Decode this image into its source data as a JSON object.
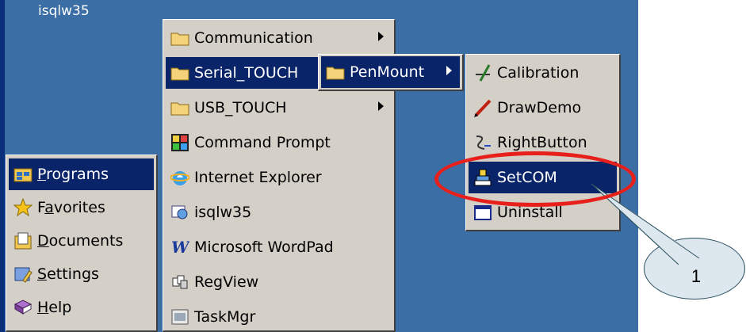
{
  "desktop": {
    "label": "isqlw35"
  },
  "start_menu": {
    "items": [
      {
        "label": "Programs",
        "icon": "programs-folder-icon",
        "selected": true,
        "underline_first": true
      },
      {
        "label": "Favorites",
        "icon": "star-icon",
        "selected": false,
        "underline_char": "a"
      },
      {
        "label": "Documents",
        "icon": "documents-icon",
        "selected": false,
        "underline_first": true
      },
      {
        "label": "Settings",
        "icon": "settings-icon",
        "selected": false,
        "underline_first": true
      },
      {
        "label": "Help",
        "icon": "help-book-icon",
        "selected": false,
        "underline_first": true
      }
    ]
  },
  "programs_menu": {
    "items": [
      {
        "label": "Communication",
        "icon": "folder-icon",
        "submenu": true
      },
      {
        "label": "Serial_TOUCH",
        "icon": "folder-icon",
        "submenu": true,
        "selected": true
      },
      {
        "label": "USB_TOUCH",
        "icon": "folder-icon",
        "submenu": true
      },
      {
        "label": "Command Prompt",
        "icon": "command-prompt-icon"
      },
      {
        "label": "Internet Explorer",
        "icon": "internet-explorer-icon"
      },
      {
        "label": "isqlw35",
        "icon": "isqlw-icon"
      },
      {
        "label": "Microsoft WordPad",
        "icon": "wordpad-icon"
      },
      {
        "label": "RegView",
        "icon": "regview-icon"
      },
      {
        "label": "TaskMgr",
        "icon": "taskmgr-icon"
      }
    ]
  },
  "serial_menu": {
    "items": [
      {
        "label": "PenMount",
        "icon": "folder-icon",
        "submenu": true,
        "selected": true
      }
    ]
  },
  "penmount_menu": {
    "items": [
      {
        "label": "Calibration",
        "icon": "calibration-icon"
      },
      {
        "label": "DrawDemo",
        "icon": "pen-icon"
      },
      {
        "label": "RightButton",
        "icon": "right-button-icon"
      },
      {
        "label": "SetCOM",
        "icon": "setcom-icon",
        "selected": true
      },
      {
        "label": "Uninstall",
        "icon": "uninstall-icon"
      }
    ]
  },
  "annotation": {
    "callout_number": "1",
    "highlight_color": "#e8201c"
  },
  "colors": {
    "desktop": "#3a6ea5",
    "menu": "#d4d0c8",
    "selection": "#0a246a"
  }
}
